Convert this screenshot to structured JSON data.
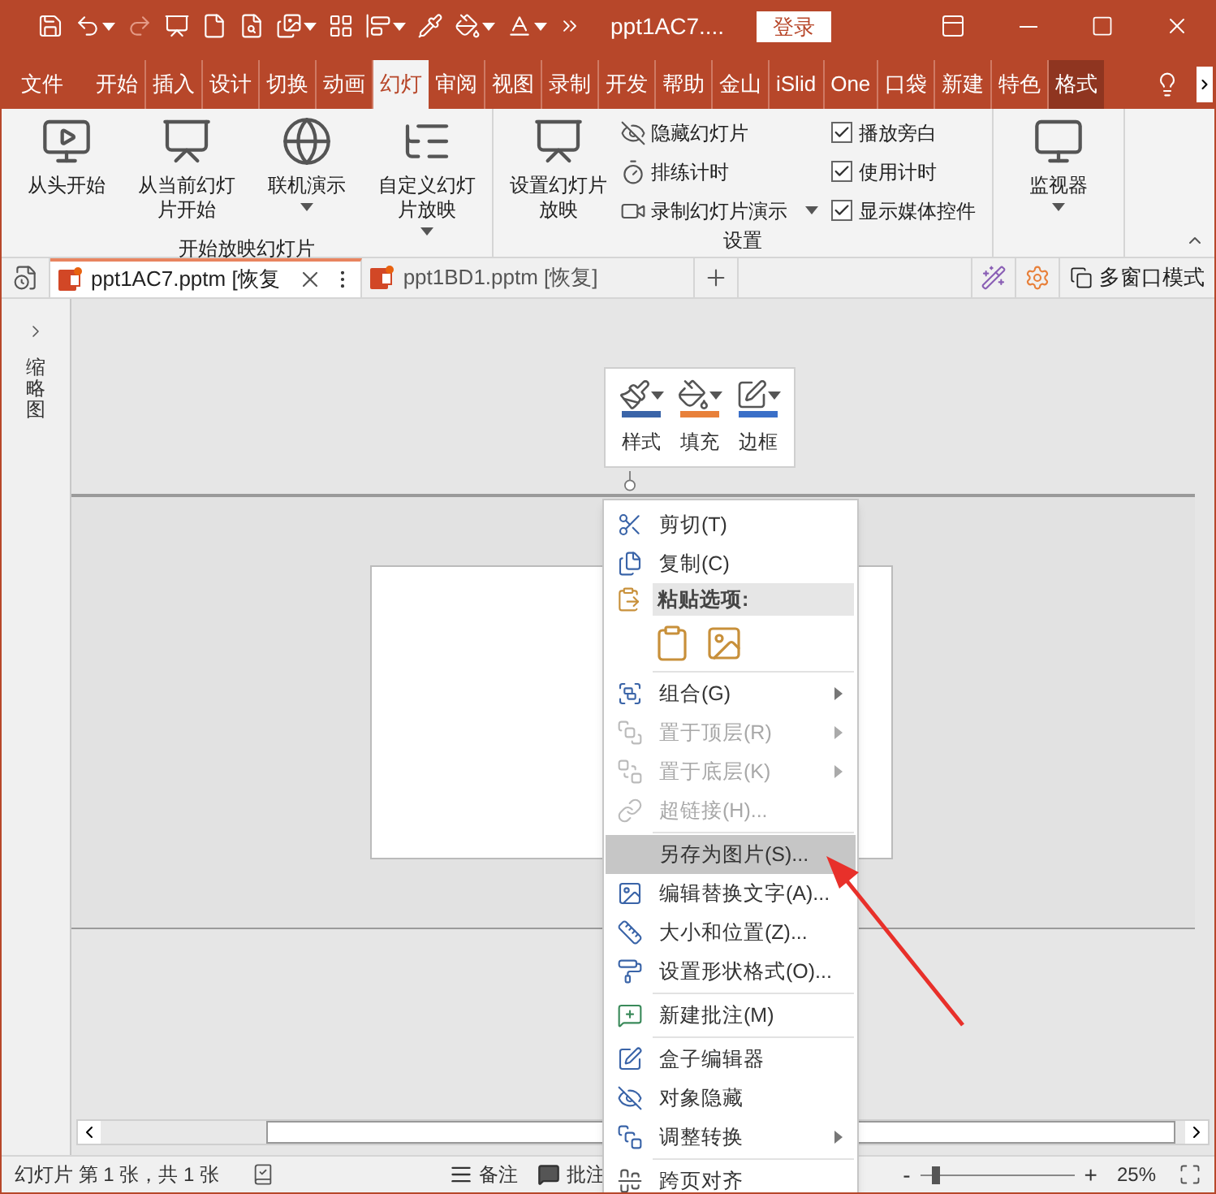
{
  "title_bar": {
    "title": "ppt1AC7....",
    "login": "登录"
  },
  "ribbon_tabs": [
    {
      "label": "文件",
      "kind": "normal",
      "selected": false
    },
    {
      "label": "开始",
      "kind": "normal",
      "selected": false
    },
    {
      "label": "插入",
      "kind": "normal",
      "selected": false
    },
    {
      "label": "设计",
      "kind": "normal",
      "selected": false
    },
    {
      "label": "切换",
      "kind": "normal",
      "selected": false
    },
    {
      "label": "动画",
      "kind": "normal",
      "selected": false
    },
    {
      "label": "幻灯",
      "kind": "normal",
      "selected": true
    },
    {
      "label": "审阅",
      "kind": "normal",
      "selected": false
    },
    {
      "label": "视图",
      "kind": "normal",
      "selected": false
    },
    {
      "label": "录制",
      "kind": "normal",
      "selected": false
    },
    {
      "label": "开发",
      "kind": "normal",
      "selected": false
    },
    {
      "label": "帮助",
      "kind": "normal",
      "selected": false
    },
    {
      "label": "金山",
      "kind": "normal",
      "selected": false
    },
    {
      "label": "iSlid",
      "kind": "normal",
      "selected": false
    },
    {
      "label": "One",
      "kind": "normal",
      "selected": false
    },
    {
      "label": "口袋",
      "kind": "normal",
      "selected": false
    },
    {
      "label": "新建",
      "kind": "normal",
      "selected": false
    },
    {
      "label": "特色",
      "kind": "normal",
      "selected": false
    },
    {
      "label": "格式",
      "kind": "contextual",
      "selected": false
    }
  ],
  "ribbon": [
    {
      "label": "开始放映幻灯片",
      "controls": [
        {
          "kind": "large",
          "label": "从头开始",
          "dropdown": false
        },
        {
          "kind": "large",
          "label": "从当前幻灯片开始",
          "dropdown": false
        },
        {
          "kind": "large",
          "label": "联机演示",
          "dropdown": true
        },
        {
          "kind": "large",
          "label": "自定义幻灯片放映",
          "dropdown": true
        }
      ]
    },
    {
      "label": "设置",
      "controls": [
        {
          "kind": "large",
          "label": "设置幻灯片放映",
          "dropdown": false
        },
        {
          "kind": "small",
          "label": "隐藏幻灯片",
          "dropdown": false
        },
        {
          "kind": "small",
          "label": "排练计时",
          "dropdown": false
        },
        {
          "kind": "small",
          "label": "录制幻灯片演示",
          "dropdown": true
        },
        {
          "kind": "check",
          "label": "播放旁白",
          "checked": true
        },
        {
          "kind": "check",
          "label": "使用计时",
          "checked": true
        },
        {
          "kind": "check",
          "label": "显示媒体控件",
          "checked": true
        }
      ]
    },
    {
      "controls": [
        {
          "kind": "large",
          "label": "监视器",
          "dropdown": true
        }
      ]
    }
  ],
  "doc_tabs": [
    {
      "label": "ppt1AC7.pptm [恢复",
      "selected": true
    },
    {
      "label": "ppt1BD1.pptm [恢复]",
      "selected": false
    }
  ],
  "window_mode": "多窗口模式",
  "sidebar": {
    "label": "缩略图"
  },
  "mini_toolbar": [
    {
      "label": "样式"
    },
    {
      "label": "填充"
    },
    {
      "label": "边框"
    }
  ],
  "context_menu": [
    {
      "kind": "item",
      "label": "剪切(T)",
      "disabled": false,
      "submenu": false,
      "selected": false
    },
    {
      "kind": "item",
      "label": "复制(C)",
      "disabled": false,
      "submenu": false,
      "selected": false
    },
    {
      "kind": "header",
      "label": "粘贴选项:"
    },
    {
      "kind": "paste_options"
    },
    {
      "kind": "separator"
    },
    {
      "kind": "item",
      "label": "组合(G)",
      "disabled": false,
      "submenu": true,
      "selected": false
    },
    {
      "kind": "item",
      "label": "置于顶层(R)",
      "disabled": true,
      "submenu": true,
      "selected": false
    },
    {
      "kind": "item",
      "label": "置于底层(K)",
      "disabled": true,
      "submenu": true,
      "selected": false
    },
    {
      "kind": "item",
      "label": "超链接(H)...",
      "disabled": true,
      "submenu": false,
      "selected": false
    },
    {
      "kind": "separator"
    },
    {
      "kind": "item",
      "label": "另存为图片(S)...",
      "disabled": false,
      "submenu": false,
      "selected": true
    },
    {
      "kind": "item",
      "label": "编辑替换文字(A)...",
      "disabled": false,
      "submenu": false,
      "selected": false
    },
    {
      "kind": "item",
      "label": "大小和位置(Z)...",
      "disabled": false,
      "submenu": false,
      "selected": false
    },
    {
      "kind": "item",
      "label": "设置形状格式(O)...",
      "disabled": false,
      "submenu": false,
      "selected": false
    },
    {
      "kind": "separator"
    },
    {
      "kind": "item",
      "label": "新建批注(M)",
      "disabled": false,
      "submenu": false,
      "selected": false
    },
    {
      "kind": "separator"
    },
    {
      "kind": "item",
      "label": "盒子编辑器",
      "disabled": false,
      "submenu": false,
      "selected": false
    },
    {
      "kind": "item",
      "label": "对象隐藏",
      "disabled": false,
      "submenu": false,
      "selected": false
    },
    {
      "kind": "item",
      "label": "调整转换",
      "disabled": false,
      "submenu": true,
      "selected": false
    },
    {
      "kind": "separator"
    },
    {
      "kind": "item",
      "label": "跨页对齐",
      "disabled": false,
      "submenu": false,
      "selected": false
    }
  ],
  "status_bar": {
    "slide_info": "幻灯片 第 1 张，共 1 张",
    "notes": "备注",
    "comments": "批注",
    "zoom_out": "-",
    "zoom_in": "+",
    "zoom": {
      "level": 0.1
    },
    "zoom_percent": "25%"
  }
}
